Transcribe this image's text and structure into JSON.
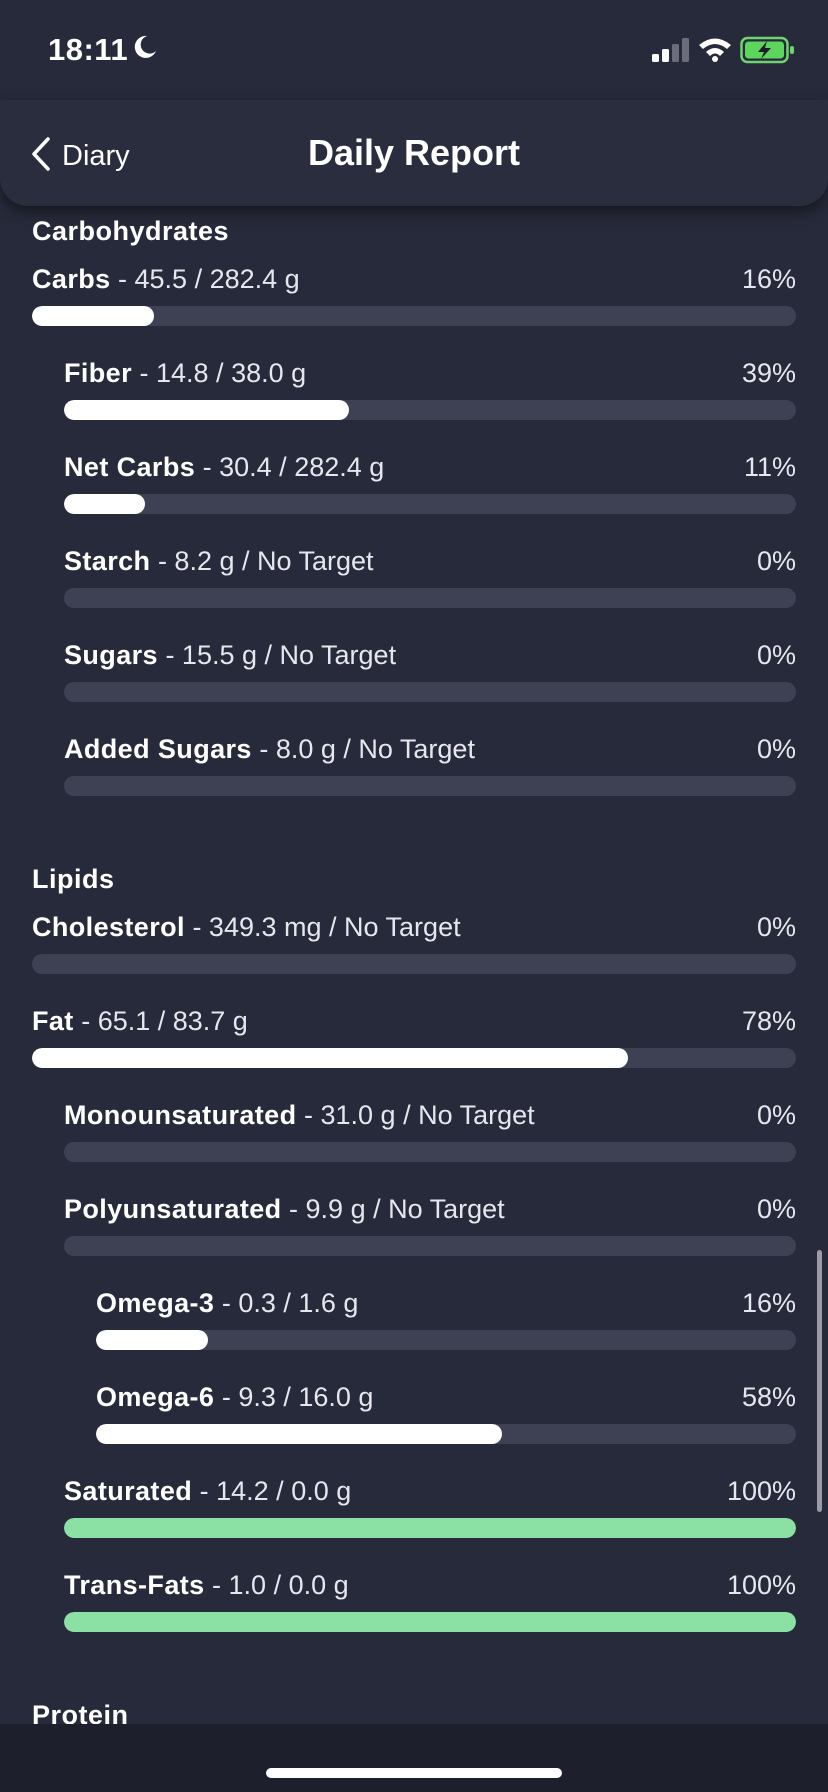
{
  "status_bar": {
    "time": "18:11"
  },
  "nav": {
    "back_label": "Diary",
    "title": "Daily Report"
  },
  "sections": [
    {
      "title": "Carbohydrates",
      "rows": [
        {
          "name": "Carbs",
          "detail": " - 45.5 / 282.4 g",
          "percent": "16%",
          "progress": 0.16,
          "indent": 0,
          "color": "#ffffff"
        },
        {
          "name": "Fiber",
          "detail": " - 14.8 / 38.0 g",
          "percent": "39%",
          "progress": 0.39,
          "indent": 1,
          "color": "#ffffff"
        },
        {
          "name": "Net Carbs",
          "detail": " - 30.4 / 282.4 g",
          "percent": "11%",
          "progress": 0.11,
          "indent": 1,
          "color": "#ffffff"
        },
        {
          "name": "Starch",
          "detail": " - 8.2 g / No Target",
          "percent": "0%",
          "progress": 0,
          "indent": 1,
          "color": "#ffffff"
        },
        {
          "name": "Sugars",
          "detail": " - 15.5 g / No Target",
          "percent": "0%",
          "progress": 0,
          "indent": 1,
          "color": "#ffffff"
        },
        {
          "name": "Added Sugars",
          "detail": " - 8.0 g / No Target",
          "percent": "0%",
          "progress": 0,
          "indent": 1,
          "color": "#ffffff"
        }
      ]
    },
    {
      "title": "Lipids",
      "rows": [
        {
          "name": "Cholesterol",
          "detail": " - 349.3 mg / No Target",
          "percent": "0%",
          "progress": 0,
          "indent": 0,
          "color": "#ffffff"
        },
        {
          "name": "Fat",
          "detail": " - 65.1 / 83.7 g",
          "percent": "78%",
          "progress": 0.78,
          "indent": 0,
          "color": "#ffffff"
        },
        {
          "name": "Monounsaturated",
          "detail": " - 31.0 g / No Target",
          "percent": "0%",
          "progress": 0,
          "indent": 1,
          "color": "#ffffff"
        },
        {
          "name": "Polyunsaturated",
          "detail": " - 9.9 g / No Target",
          "percent": "0%",
          "progress": 0,
          "indent": 1,
          "color": "#ffffff"
        },
        {
          "name": "Omega-3",
          "detail": " - 0.3 / 1.6 g",
          "percent": "16%",
          "progress": 0.16,
          "indent": 2,
          "color": "#ffffff"
        },
        {
          "name": "Omega-6",
          "detail": " - 9.3 / 16.0 g",
          "percent": "58%",
          "progress": 0.58,
          "indent": 2,
          "color": "#ffffff"
        },
        {
          "name": "Saturated",
          "detail": " - 14.2 / 0.0 g",
          "percent": "100%",
          "progress": 1,
          "indent": 1,
          "color": "#8be0a4"
        },
        {
          "name": "Trans-Fats",
          "detail": " - 1.0 / 0.0 g",
          "percent": "100%",
          "progress": 1,
          "indent": 1,
          "color": "#8be0a4"
        }
      ]
    },
    {
      "title": "Protein",
      "rows": []
    }
  ],
  "colors": {
    "background": "#272a3a",
    "track": "#3e4153",
    "over_target": "#8be0a4"
  }
}
